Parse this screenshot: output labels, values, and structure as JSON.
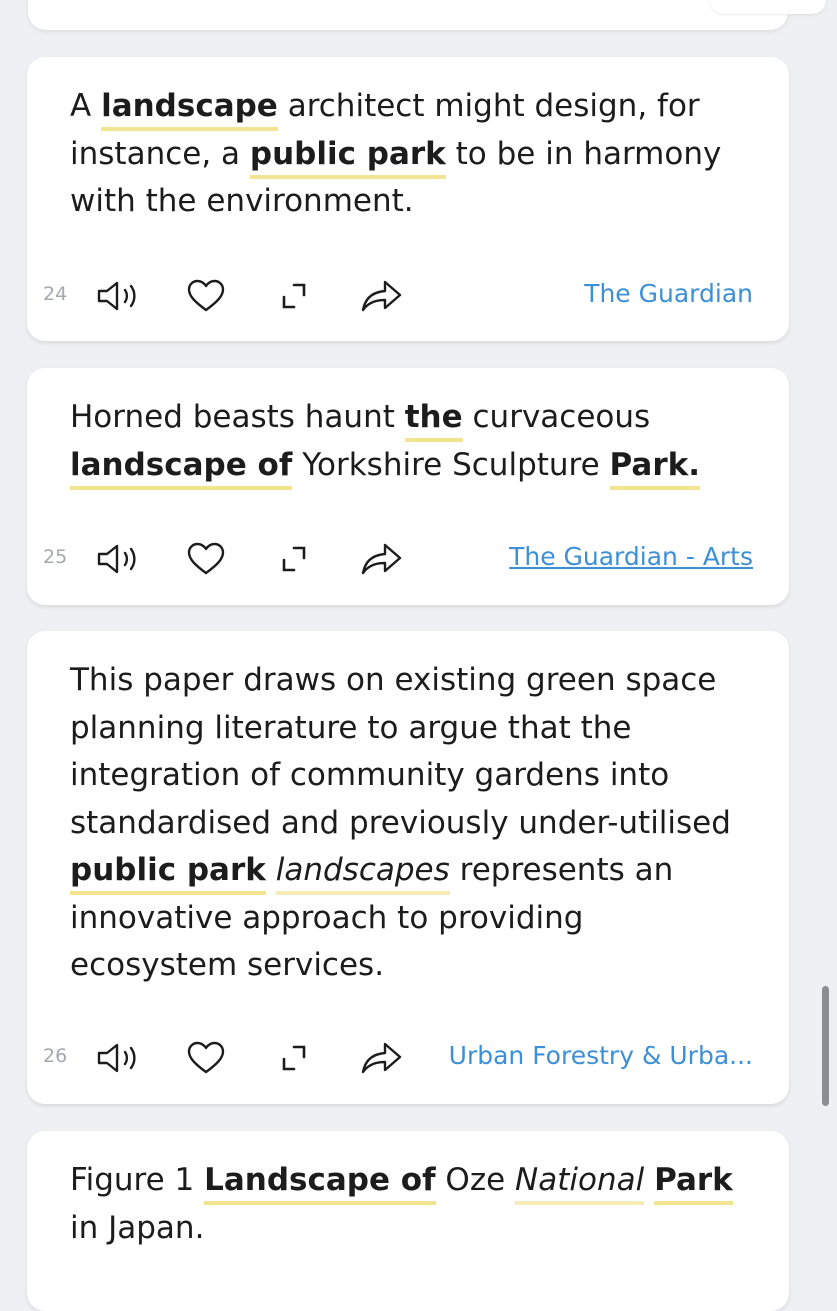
{
  "cards": [
    {
      "number": "24",
      "source": "The Guardian",
      "parts": [
        "A ",
        "landscape",
        " architect might design, for instance, a ",
        "public park",
        " to be in harmony with the environment."
      ]
    },
    {
      "number": "25",
      "source": "The Guardian - Arts",
      "parts": [
        "Horned beasts haunt ",
        "the",
        " curvaceous ",
        "landscape of",
        " Yorkshire Sculpture ",
        "Park."
      ]
    },
    {
      "number": "26",
      "source": "Urban Forestry & Urba...",
      "parts": [
        "This paper draws on existing green space planning literature to argue that the integration of community gardens into standardised and previously under-utilised ",
        "public park",
        " ",
        "landscapes",
        " represents an innovative approach to providing ecosystem services."
      ]
    },
    {
      "parts": [
        "Figure 1 ",
        "Landscape of",
        " Oze ",
        "National",
        " ",
        "Park",
        " in Japan."
      ]
    }
  ],
  "icons": {
    "listen": "speaker-icon",
    "favorite": "heart-icon",
    "expand": "expand-icon",
    "share": "share-icon"
  },
  "colors": {
    "highlight": "#f3e492",
    "source_link": "#3d8fd6",
    "background": "#eef0f3"
  }
}
